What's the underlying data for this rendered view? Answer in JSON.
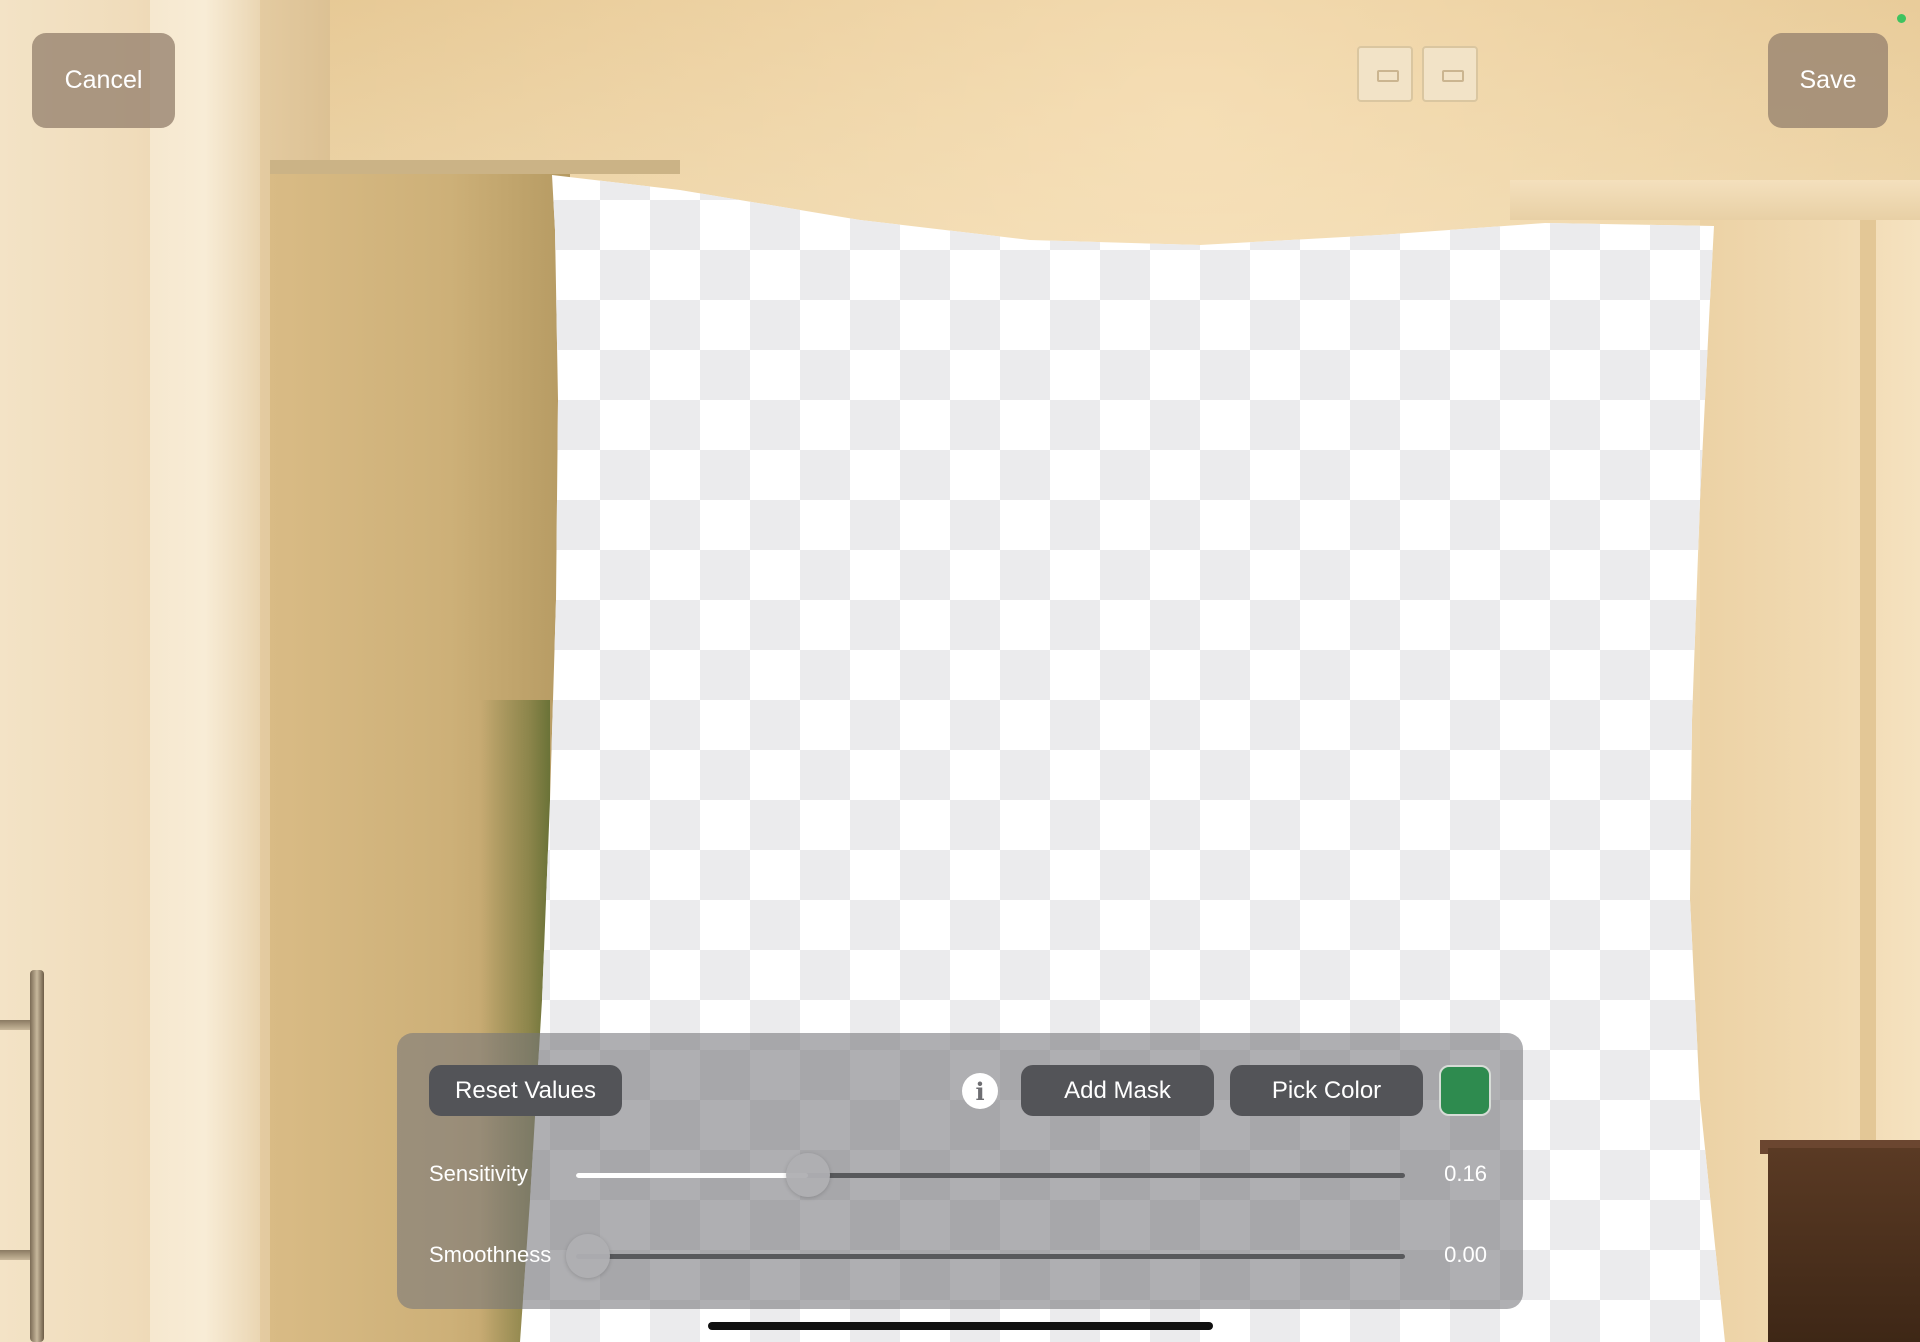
{
  "top_bar": {
    "cancel_label": "Cancel",
    "save_label": "Save"
  },
  "toolbar": {
    "reset_label": "Reset Values",
    "info_icon": "info-icon",
    "add_mask_label": "Add Mask",
    "pick_color_label": "Pick Color",
    "key_color": "#2e8b4f"
  },
  "sliders": [
    {
      "label": "Sensitivity",
      "value_text": "0.16",
      "level": 0.28
    },
    {
      "label": "Smoothness",
      "value_text": "0.00",
      "level": 0.0
    }
  ],
  "colors": {
    "status_dot": "#3ec35f"
  }
}
